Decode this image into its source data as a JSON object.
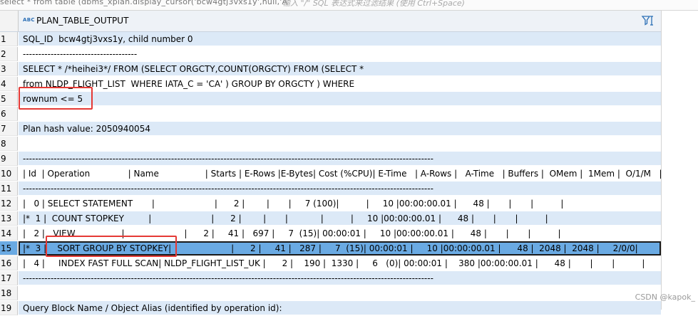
{
  "editor_line": "select * from table (dbms_xplan.display_cursor('bcw4gtj3vxs1y',null,'A'",
  "editor_hint": "输入 \"/\" SQL 表达式来过滤结果 (使用 Ctrl+Space)",
  "column": {
    "type_badge": "ABC",
    "title": "PLAN_TABLE_OUTPUT",
    "filter_icon": "filter-icon"
  },
  "rows": [
    {
      "n": "1",
      "text": "SQL_ID  bcw4gtj3vxs1y, child number 0"
    },
    {
      "n": "2",
      "text": "-------------------------------------"
    },
    {
      "n": "3",
      "text": "SELECT * /*heihei3*/ FROM (SELECT ORGCTY,COUNT(ORGCTY) FROM (SELECT *"
    },
    {
      "n": "4",
      "text": "from NLDP_FLIGHT_LIST  WHERE IATA_C = 'CA' ) GROUP BY ORGCTY ) WHERE"
    },
    {
      "n": "5",
      "text": "rownum <= 5"
    },
    {
      "n": "6",
      "text": ""
    },
    {
      "n": "7",
      "text": "Plan hash value: 2050940054"
    },
    {
      "n": "8",
      "text": ""
    },
    {
      "n": "9",
      "text": "-------------------------------------------------------------------------------------------------------------------------------------"
    },
    {
      "n": "10",
      "text": "| Id  | Operation              | Name                 | Starts | E-Rows |E-Bytes| Cost (%CPU)| E-Time   | A-Rows |   A-Time   | Buffers |  OMem |  1Mem |  O/1/M   |"
    },
    {
      "n": "11",
      "text": "-------------------------------------------------------------------------------------------------------------------------------------"
    },
    {
      "n": "12",
      "text": "|   0 | SELECT STATEMENT       |                      |      2 |        |       |     7 (100)|          |     10 |00:00:00.01 |      48 |       |       |          |"
    },
    {
      "n": "13",
      "text": "|*  1 |  COUNT STOPKEY         |                      |      2 |        |       |            |          |     10 |00:00:00.01 |      48 |       |       |          |"
    },
    {
      "n": "14",
      "text": "|   2 |   VIEW                 |                      |      2 |     41 |   697 |     7  (15)| 00:00:01 |     10 |00:00:00.01 |      48 |       |       |          |"
    },
    {
      "n": "15",
      "text": "|*  3 |    SORT GROUP BY STOPKEY|                      |      2 |     41 |   287 |     7  (15)| 00:00:01 |     10 |00:00:00.01 |      48 |  2048 |  2048 |     2/0/0|"
    },
    {
      "n": "16",
      "text": "|   4 |     INDEX FAST FULL SCAN| NLDP_FLIGHT_LIST_UK |      2 |    190 |  1330 |     6   (0)| 00:00:01 |    380 |00:00:00.01 |      48 |       |       |          |"
    },
    {
      "n": "17",
      "text": "-------------------------------------------------------------------------------------------------------------------------------------"
    },
    {
      "n": "18",
      "text": ""
    },
    {
      "n": "19",
      "text": "Query Block Name / Object Alias (identified by operation id):"
    }
  ],
  "selected_row": 15,
  "watermark": "CSDN @kapok_",
  "colors": {
    "row_stripe": "#dce9f7",
    "selected": "#6aaae3",
    "highlight_box": "#e53935"
  }
}
